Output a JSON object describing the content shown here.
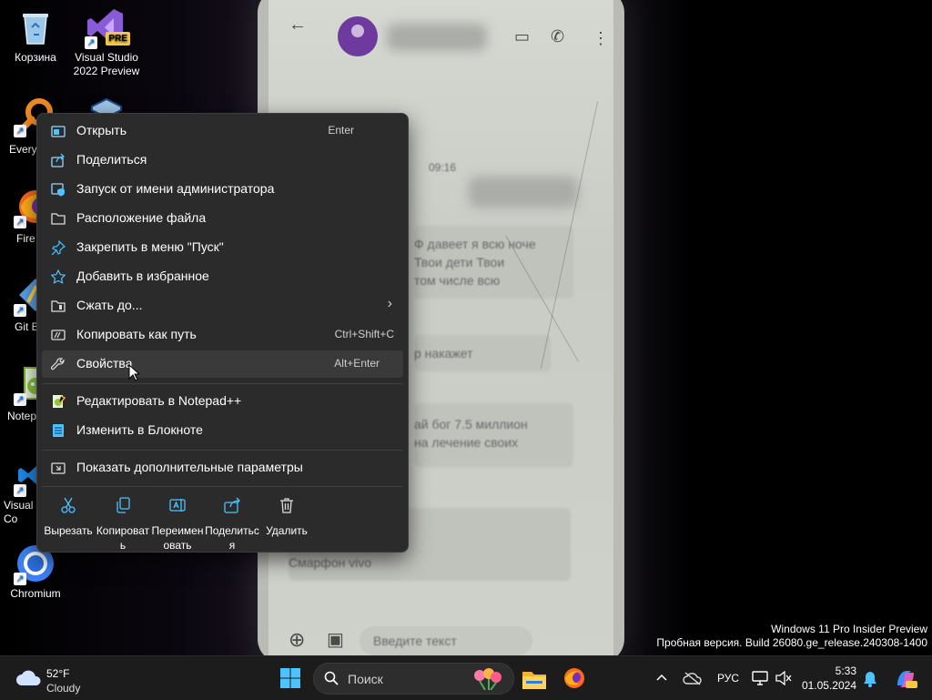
{
  "desktop": {
    "icons": [
      {
        "label": "Корзина",
        "icon": "recycle-bin-icon"
      },
      {
        "label": "Visual Studio\n2022 Preview",
        "icon": "visual-studio-preview-icon",
        "badge": "PRE"
      },
      {
        "label": "Every",
        "icon": "everything-search-icon"
      },
      {
        "label": "Fire",
        "icon": "firefox-icon"
      },
      {
        "label": "Git B",
        "icon": "git-bash-icon"
      },
      {
        "label": "Notep",
        "icon": "notepad-plus-plus-icon"
      },
      {
        "label": "Visual\nCo",
        "icon": "vscode-icon"
      },
      {
        "label": "Chromium",
        "icon": "chromium-icon"
      }
    ]
  },
  "context_menu": {
    "items": [
      {
        "label": "Открыть",
        "shortcut": "Enter",
        "icon": "open-icon"
      },
      {
        "label": "Поделиться",
        "icon": "share-icon"
      },
      {
        "label": "Запуск от имени администратора",
        "icon": "shield-run-icon"
      },
      {
        "label": "Расположение файла",
        "icon": "folder-icon"
      },
      {
        "label": "Закрепить в меню \"Пуск\"",
        "icon": "pin-icon"
      },
      {
        "label": "Добавить в избранное",
        "icon": "star-icon"
      },
      {
        "label": "Сжать до...",
        "icon": "zip-icon",
        "has_submenu": true
      },
      {
        "label": "Копировать как путь",
        "shortcut": "Ctrl+Shift+C",
        "icon": "copy-path-icon"
      },
      {
        "label": "Свойства",
        "shortcut": "Alt+Enter",
        "icon": "wrench-icon",
        "hovered": true
      },
      {
        "label": "Редактировать в Notepad++",
        "icon": "notepad-plus-plus-icon"
      },
      {
        "label": "Изменить в Блокноте",
        "icon": "notepad-icon"
      },
      {
        "label": "Показать дополнительные параметры",
        "icon": "more-options-icon"
      }
    ],
    "actions": [
      {
        "label": "Вырезать",
        "icon": "cut-icon"
      },
      {
        "label": "Копироват\nь",
        "icon": "copy-icon"
      },
      {
        "label": "Переимен\nовать",
        "icon": "rename-icon"
      },
      {
        "label": "Поделитьс\nя",
        "icon": "share-icon"
      },
      {
        "label": "Удалить",
        "icon": "trash-icon"
      }
    ]
  },
  "watermark": {
    "line1": "Windows 11 Pro Insider Preview",
    "line2": "Пробная версия. Build 26080.ge_release.240308-1400"
  },
  "taskbar": {
    "weather": {
      "temp": "52°F",
      "desc": "Cloudy"
    },
    "search_placeholder": "Поиск",
    "language": "РУС",
    "time": "5:33",
    "date": "01.05.2024"
  },
  "phone_wallpaper": {
    "date_label": "09:16",
    "messages": [
      "Ф давеет я всю ноче\nТвои дети Твои\nтом числе всю",
      "р накажет",
      "ай бог 7.5 миллион\nна лечение своих",
      "бога пока даду\nчтобы тебя наказал\nСмарфон vivo"
    ],
    "input_placeholder": "Введите текст"
  },
  "colors": {
    "menu_bg": "#2b2b2b",
    "menu_hover": "#3a3a3a",
    "taskbar_bg": "#1c1c1c",
    "accent_blue": "#4cc2ff"
  }
}
